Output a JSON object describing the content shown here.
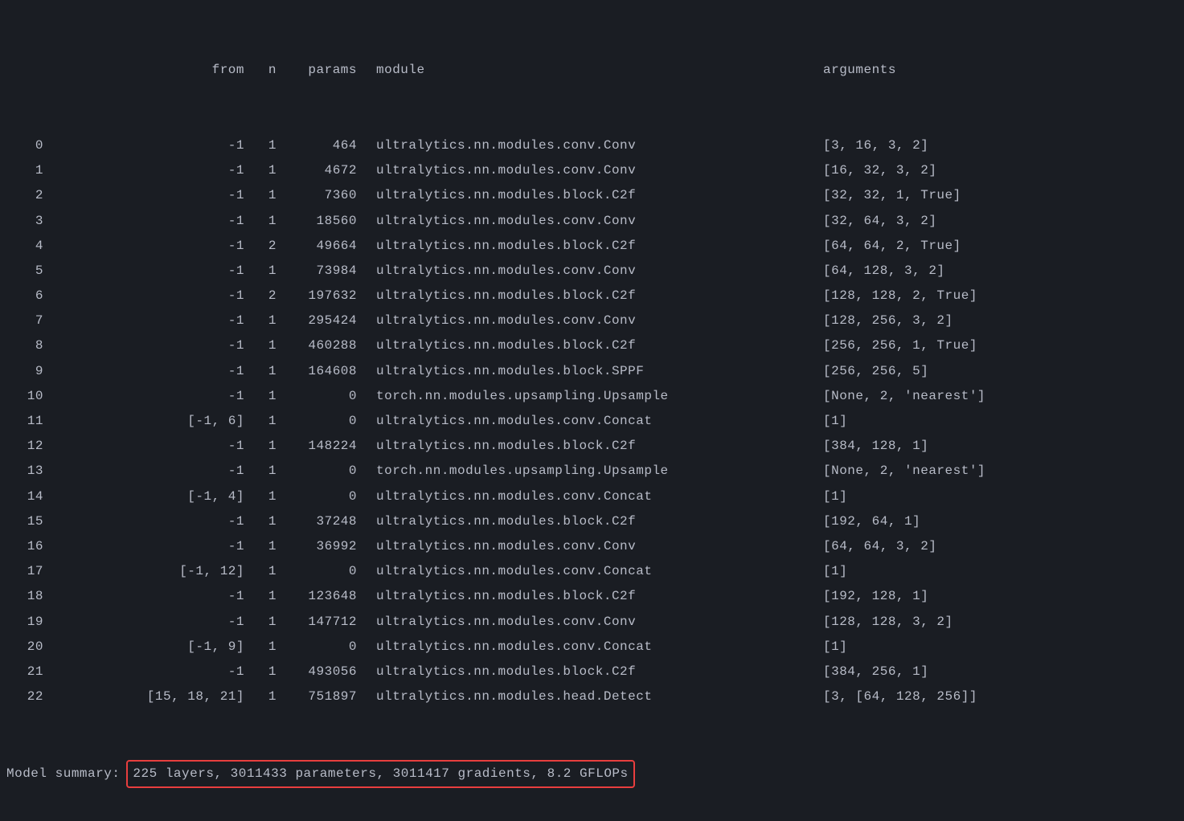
{
  "header": {
    "from": "from",
    "n": "n",
    "params": "params",
    "module": "module",
    "arguments": "arguments"
  },
  "rows": [
    {
      "idx": " 0",
      "from": "-1",
      "n": "1",
      "params": "464",
      "module": "ultralytics.nn.modules.conv.Conv",
      "arguments": "[3, 16, 3, 2]"
    },
    {
      "idx": " 1",
      "from": "-1",
      "n": "1",
      "params": "4672",
      "module": "ultralytics.nn.modules.conv.Conv",
      "arguments": "[16, 32, 3, 2]"
    },
    {
      "idx": " 2",
      "from": "-1",
      "n": "1",
      "params": "7360",
      "module": "ultralytics.nn.modules.block.C2f",
      "arguments": "[32, 32, 1, True]"
    },
    {
      "idx": " 3",
      "from": "-1",
      "n": "1",
      "params": "18560",
      "module": "ultralytics.nn.modules.conv.Conv",
      "arguments": "[32, 64, 3, 2]"
    },
    {
      "idx": " 4",
      "from": "-1",
      "n": "2",
      "params": "49664",
      "module": "ultralytics.nn.modules.block.C2f",
      "arguments": "[64, 64, 2, True]"
    },
    {
      "idx": " 5",
      "from": "-1",
      "n": "1",
      "params": "73984",
      "module": "ultralytics.nn.modules.conv.Conv",
      "arguments": "[64, 128, 3, 2]"
    },
    {
      "idx": " 6",
      "from": "-1",
      "n": "2",
      "params": "197632",
      "module": "ultralytics.nn.modules.block.C2f",
      "arguments": "[128, 128, 2, True]"
    },
    {
      "idx": " 7",
      "from": "-1",
      "n": "1",
      "params": "295424",
      "module": "ultralytics.nn.modules.conv.Conv",
      "arguments": "[128, 256, 3, 2]"
    },
    {
      "idx": " 8",
      "from": "-1",
      "n": "1",
      "params": "460288",
      "module": "ultralytics.nn.modules.block.C2f",
      "arguments": "[256, 256, 1, True]"
    },
    {
      "idx": " 9",
      "from": "-1",
      "n": "1",
      "params": "164608",
      "module": "ultralytics.nn.modules.block.SPPF",
      "arguments": "[256, 256, 5]"
    },
    {
      "idx": "10",
      "from": "-1",
      "n": "1",
      "params": "0",
      "module": "torch.nn.modules.upsampling.Upsample",
      "arguments": "[None, 2, 'nearest']"
    },
    {
      "idx": "11",
      "from": "[-1, 6]",
      "n": "1",
      "params": "0",
      "module": "ultralytics.nn.modules.conv.Concat",
      "arguments": "[1]"
    },
    {
      "idx": "12",
      "from": "-1",
      "n": "1",
      "params": "148224",
      "module": "ultralytics.nn.modules.block.C2f",
      "arguments": "[384, 128, 1]"
    },
    {
      "idx": "13",
      "from": "-1",
      "n": "1",
      "params": "0",
      "module": "torch.nn.modules.upsampling.Upsample",
      "arguments": "[None, 2, 'nearest']"
    },
    {
      "idx": "14",
      "from": "[-1, 4]",
      "n": "1",
      "params": "0",
      "module": "ultralytics.nn.modules.conv.Concat",
      "arguments": "[1]"
    },
    {
      "idx": "15",
      "from": "-1",
      "n": "1",
      "params": "37248",
      "module": "ultralytics.nn.modules.block.C2f",
      "arguments": "[192, 64, 1]"
    },
    {
      "idx": "16",
      "from": "-1",
      "n": "1",
      "params": "36992",
      "module": "ultralytics.nn.modules.conv.Conv",
      "arguments": "[64, 64, 3, 2]"
    },
    {
      "idx": "17",
      "from": "[-1, 12]",
      "n": "1",
      "params": "0",
      "module": "ultralytics.nn.modules.conv.Concat",
      "arguments": "[1]"
    },
    {
      "idx": "18",
      "from": "-1",
      "n": "1",
      "params": "123648",
      "module": "ultralytics.nn.modules.block.C2f",
      "arguments": "[192, 128, 1]"
    },
    {
      "idx": "19",
      "from": "-1",
      "n": "1",
      "params": "147712",
      "module": "ultralytics.nn.modules.conv.Conv",
      "arguments": "[128, 128, 3, 2]"
    },
    {
      "idx": "20",
      "from": "[-1, 9]",
      "n": "1",
      "params": "0",
      "module": "ultralytics.nn.modules.conv.Concat",
      "arguments": "[1]"
    },
    {
      "idx": "21",
      "from": "-1",
      "n": "1",
      "params": "493056",
      "module": "ultralytics.nn.modules.block.C2f",
      "arguments": "[384, 256, 1]"
    },
    {
      "idx": "22",
      "from": "[15, 18, 21]",
      "n": "1",
      "params": "751897",
      "module": "ultralytics.nn.modules.head.Detect",
      "arguments": "[3, [64, 128, 256]]"
    }
  ],
  "summary": {
    "label": "Model summary:",
    "text": "225 layers, 3011433 parameters, 3011417 gradients, 8.2 GFLOPs"
  }
}
